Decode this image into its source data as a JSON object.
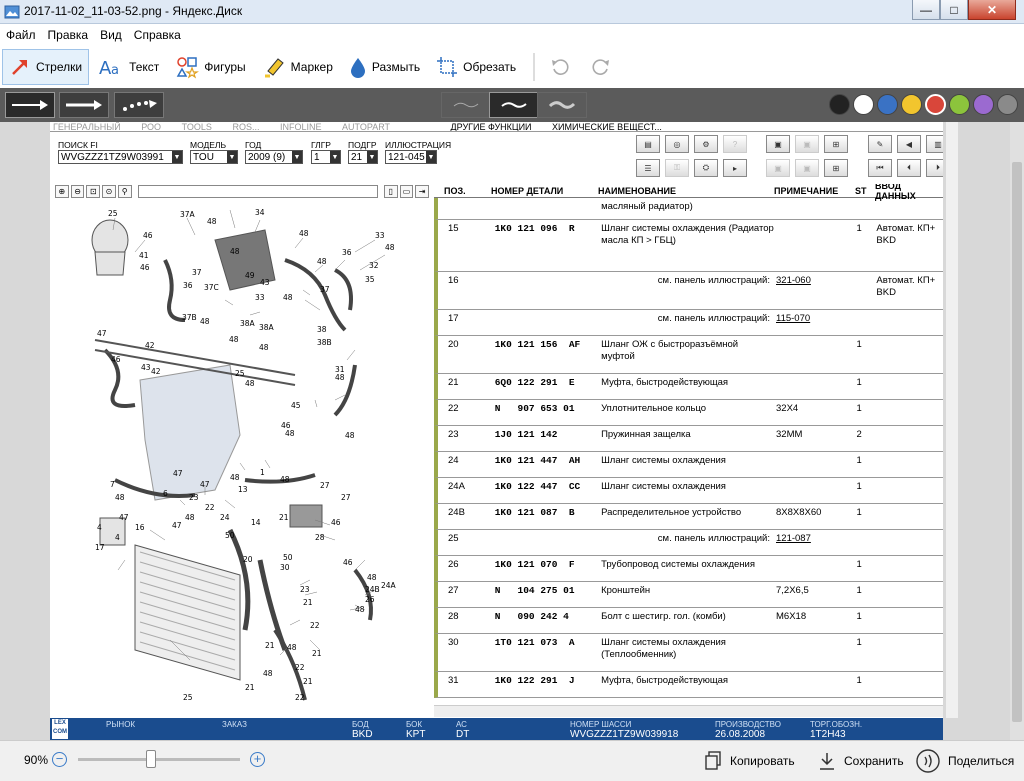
{
  "window": {
    "title": "2017-11-02_11-03-52.png - Яндекс.Диск",
    "minimize": "—",
    "maximize": "□",
    "close": "✕"
  },
  "menu": [
    "Файл",
    "Правка",
    "Вид",
    "Справка"
  ],
  "toolbar": {
    "arrows": "Стрелки",
    "text": "Текст",
    "shapes": "Фигуры",
    "marker": "Маркер",
    "blur": "Размыть",
    "crop": "Обрезать"
  },
  "colors": [
    "#222222",
    "#ffffff",
    "#3a72c4",
    "#f2c52e",
    "#d9463a",
    "#8cc43c",
    "#9b6ad0",
    "#8a8a8a"
  ],
  "doc": {
    "tabs": [
      "ГЕНЕРАЛЬНЫЙ",
      "РОО",
      "TOOLS",
      "ROS...",
      "INFOLINE",
      "AUTOPART",
      "ДРУГИЕ ФУНКЦИИ",
      "ХИМИЧЕСКИЕ ВЕЩЕСТ..."
    ],
    "fields": {
      "search_label": "ПОИСК FI",
      "search_value": "WVGZZZ1TZ9W03991",
      "model_label": "МОДЕЛЬ",
      "model_value": "TOU",
      "year_label": "ГОД",
      "year_value": "2009 (9)",
      "group_label": "ГЛГР",
      "group_value": "1",
      "subgroup_label": "ПОДГР",
      "subgroup_value": "21",
      "illus_label": "ИЛЛЮСТРАЦИЯ",
      "illus_value": "121-045"
    },
    "table_headers": [
      "ПОЗ.",
      "НОМЕР ДЕТАЛИ",
      "НАИМЕНОВАНИЕ",
      "ПРИМЕЧАНИЕ",
      "ST",
      "ВВОД ДАННЫХ"
    ],
    "rows": [
      {
        "pos": "",
        "part": "",
        "name": "масляный радиатор)",
        "note": "",
        "st": "",
        "data": ""
      },
      {
        "pos": "15",
        "part": "1K0 121 096  R",
        "name": "Шланг системы охлаждения (Радиатор масла КП > ГБЦ)",
        "note": "",
        "st": "1",
        "data": "Автомат. КП+ BKD"
      },
      {
        "pos": "16",
        "part": "",
        "name": "см. панель иллюстраций:",
        "note": "321-060",
        "st": "",
        "data": "Автомат. КП+ BKD",
        "ref": true
      },
      {
        "pos": "17",
        "part": "",
        "name": "см. панель иллюстраций:",
        "note": "115-070",
        "st": "",
        "data": "",
        "ref": true
      },
      {
        "pos": "20",
        "part": "1K0 121 156  AF",
        "name": "Шланг ОЖ с быстроразъёмной муфтой",
        "note": "",
        "st": "1",
        "data": ""
      },
      {
        "pos": "21",
        "part": "6Q0 122 291  E",
        "name": "Муфта, быстродействующая",
        "note": "",
        "st": "1",
        "data": ""
      },
      {
        "pos": "22",
        "part": "N   907 653 01",
        "name": "Уплотнительное кольцо",
        "note": "32X4",
        "st": "1",
        "data": ""
      },
      {
        "pos": "23",
        "part": "1J0 121 142",
        "name": "Пружинная защелка",
        "note": "32MM",
        "st": "2",
        "data": ""
      },
      {
        "pos": "24",
        "part": "1K0 121 447  AH",
        "name": "Шланг системы охлаждения",
        "note": "",
        "st": "1",
        "data": ""
      },
      {
        "pos": "24A",
        "part": "1K0 122 447  CC",
        "name": "Шланг системы охлаждения",
        "note": "",
        "st": "1",
        "data": ""
      },
      {
        "pos": "24B",
        "part": "1K0 121 087  B",
        "name": "Распределительное устройство",
        "note": "8X8X8X60",
        "st": "1",
        "data": ""
      },
      {
        "pos": "25",
        "part": "",
        "name": "см. панель иллюстраций:",
        "note": "121-087",
        "st": "",
        "data": "",
        "ref": true
      },
      {
        "pos": "26",
        "part": "1K0 121 070  F",
        "name": "Трубопровод системы охлаждения",
        "note": "",
        "st": "1",
        "data": ""
      },
      {
        "pos": "27",
        "part": "N   104 275 01",
        "name": "Кронштейн",
        "note": "7,2X6,5",
        "st": "1",
        "data": ""
      },
      {
        "pos": "28",
        "part": "N   090 242 4",
        "name": "Болт с шестигр. гол. (комби)",
        "note": "M6X18",
        "st": "1",
        "data": ""
      },
      {
        "pos": "30",
        "part": "1T0 121 073  A",
        "name": "Шланг системы охлаждения (Теплообменник)",
        "note": "",
        "st": "1",
        "data": ""
      },
      {
        "pos": "31",
        "part": "1K0 122 291  J",
        "name": "Муфта, быстродействующая",
        "note": "",
        "st": "1",
        "data": ""
      }
    ],
    "bottom": {
      "logo": "LEX COM",
      "market_label": "РЫНОК",
      "order_label": "ЗАКАЗ",
      "bod_label": "БОД",
      "bod_value": "BKD",
      "bok_label": "БОК",
      "bok_value": "KPT",
      "ac_label": "АС",
      "ac_value": "DT",
      "chassis_label": "НОМЕР ШАССИ",
      "chassis_value": "WVGZZZ1TZ9W039918",
      "prod_label": "ПРОИЗВОДСТВО",
      "prod_value": "26.08.2008",
      "trade_label": "ТОРГ.ОБОЗН.",
      "trade_value": "1T2H43"
    }
  },
  "status": {
    "zoom": "90%",
    "zoom_level": 0.45,
    "copy": "Копировать",
    "save": "Сохранить",
    "share": "Поделиться"
  }
}
